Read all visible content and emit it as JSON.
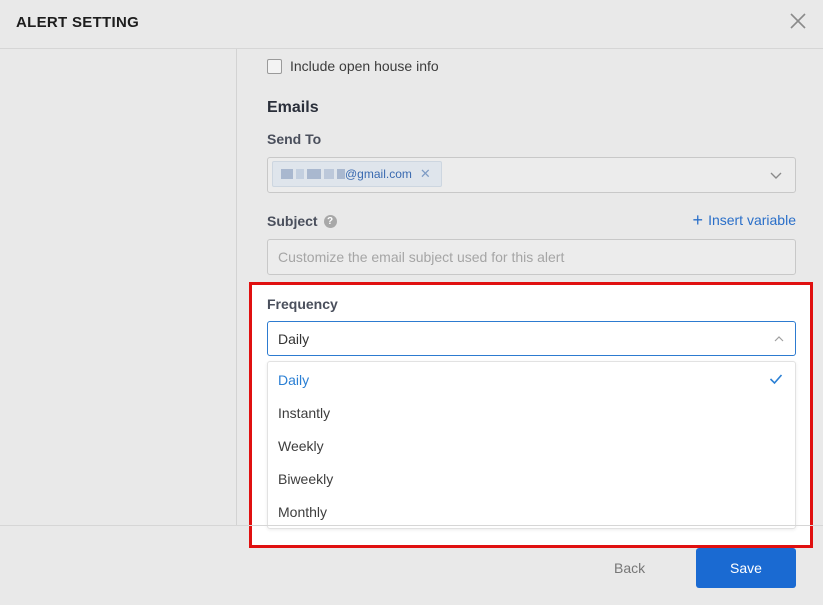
{
  "header": {
    "title": "ALERT SETTING"
  },
  "form": {
    "open_house_label": "Include open house info",
    "emails_title": "Emails",
    "send_to_label": "Send To",
    "send_to_tag": "@gmail.com",
    "subject_label": "Subject",
    "subject_help": "?",
    "insert_variable": "Insert variable",
    "subject_placeholder": "Customize the email subject used for this alert",
    "frequency_label": "Frequency",
    "frequency_value": "Daily",
    "frequency_options": [
      "Daily",
      "Instantly",
      "Weekly",
      "Biweekly",
      "Monthly"
    ]
  },
  "footer": {
    "back_label": "Back",
    "save_label": "Save"
  },
  "colors": {
    "accent": "#1a6ad2",
    "highlight": "#e01010",
    "selected_option": "#2a7fd4"
  }
}
